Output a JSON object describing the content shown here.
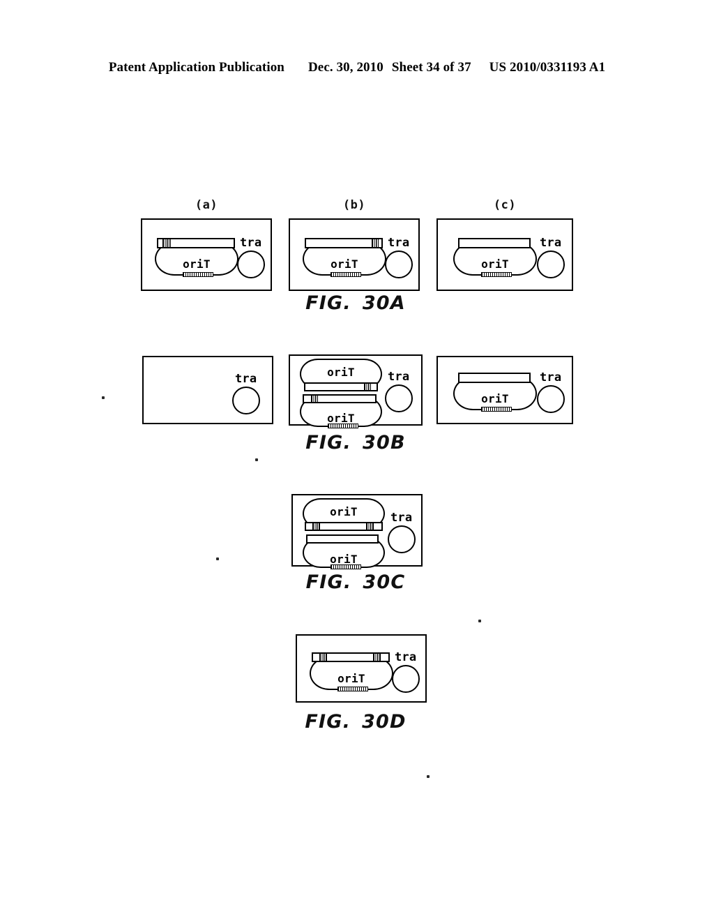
{
  "header": {
    "publication": "Patent Application Publication",
    "date": "Dec. 30, 2010",
    "sheet": "Sheet 34 of 37",
    "patent_number": "US 2010/0331193 A1"
  },
  "figures": [
    {
      "caption_prefix": "FIG.",
      "caption_number": "30A",
      "panels": [
        {
          "sublabel": "(a)",
          "plasmids": [
            {
              "label": "oriT"
            }
          ],
          "bars": [
            {
              "hatches": [
                "left"
              ]
            }
          ],
          "tra_label": "tra"
        },
        {
          "sublabel": "(b)",
          "plasmids": [
            {
              "label": "oriT"
            }
          ],
          "bars": [
            {
              "hatches": [
                "right"
              ]
            }
          ],
          "tra_label": "tra"
        },
        {
          "sublabel": "(c)",
          "plasmids": [
            {
              "label": "oriT"
            }
          ],
          "bars": [
            {
              "hatches": []
            }
          ],
          "tra_label": "tra"
        }
      ]
    },
    {
      "caption_prefix": "FIG.",
      "caption_number": "30B",
      "panels": [
        {
          "sublabel": "",
          "plasmids": [],
          "bars": [],
          "tra_label": "tra"
        },
        {
          "sublabel": "",
          "plasmids": [
            {
              "label": "oriT"
            },
            {
              "label": "oriT"
            }
          ],
          "bars": [
            {
              "hatches": [
                "right"
              ]
            },
            {
              "hatches": [
                "left"
              ]
            }
          ],
          "tra_label": "tra"
        },
        {
          "sublabel": "",
          "plasmids": [
            {
              "label": "oriT"
            }
          ],
          "bars": [
            {
              "hatches": []
            }
          ],
          "tra_label": "tra"
        }
      ]
    },
    {
      "caption_prefix": "FIG.",
      "caption_number": "30C",
      "panels": [
        {
          "sublabel": "",
          "plasmids": [
            {
              "label": "oriT"
            },
            {
              "label": "oriT"
            }
          ],
          "bars": [
            {
              "hatches": [
                "left",
                "right"
              ]
            },
            {
              "hatches": []
            }
          ],
          "tra_label": "tra"
        }
      ]
    },
    {
      "caption_prefix": "FIG.",
      "caption_number": "30D",
      "panels": [
        {
          "sublabel": "",
          "plasmids": [
            {
              "label": "oriT"
            }
          ],
          "bars": [
            {
              "hatches": [
                "left",
                "right"
              ]
            }
          ],
          "tra_label": "tra"
        }
      ]
    }
  ]
}
